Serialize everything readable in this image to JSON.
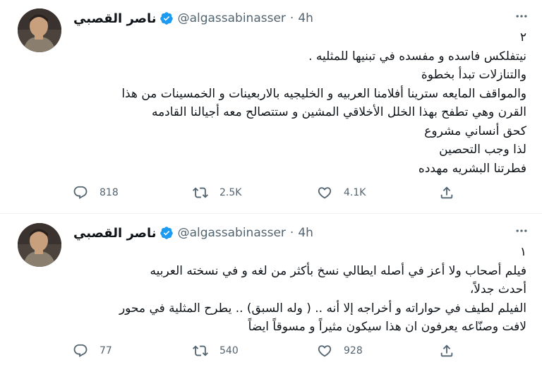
{
  "author": {
    "name": "ناصر القصبي",
    "handle": "@algassabinasser"
  },
  "tweets": [
    {
      "time": "4h",
      "lines": [
        "٢",
        "نيتفلكس فاسده و مفسده في تبنيها للمثليه .",
        "والتنازلات تبدأ بخطوة",
        "والمواقف المايعه سترينا أفلامنا العربيه و الخليجيه بالاربعينات و الخمسينات من هذا",
        "القرن وهي تطفح بهذا الخلل الأخلاقي المشين و ستتصالح معه أجيالنا القادمه",
        "كحق أنساني مشروع",
        "لذا وجب التحصين",
        "فطرتنا البشريه مهدده"
      ],
      "replies": "818",
      "retweets": "2.5K",
      "likes": "4.1K"
    },
    {
      "time": "4h",
      "lines": [
        "١",
        "فيلم أصحاب ولا أعز في أصله ايطالي نسخ بأكثر من لغه و في نسخته العربيه",
        "أحدث جدلاً،",
        " الفيلم لطيف في حواراته و أخراجه إلا أنه .. ( وله السبق) .. يطرح المثلية في محور",
        "لافت وصنّاعه يعرفون ان هذا سيكون مثيراً و مسوقاً ايضاً"
      ],
      "replies": "77",
      "retweets": "540",
      "likes": "928"
    }
  ],
  "separator": "·",
  "icons": [
    "avatar",
    "verified-badge-icon",
    "more-icon",
    "reply-icon",
    "retweet-icon",
    "like-icon",
    "share-icon"
  ],
  "colors": {
    "text": "#0f1419",
    "secondary": "#536471",
    "verified": "#1d9bf0",
    "divider": "#eff3f4"
  }
}
